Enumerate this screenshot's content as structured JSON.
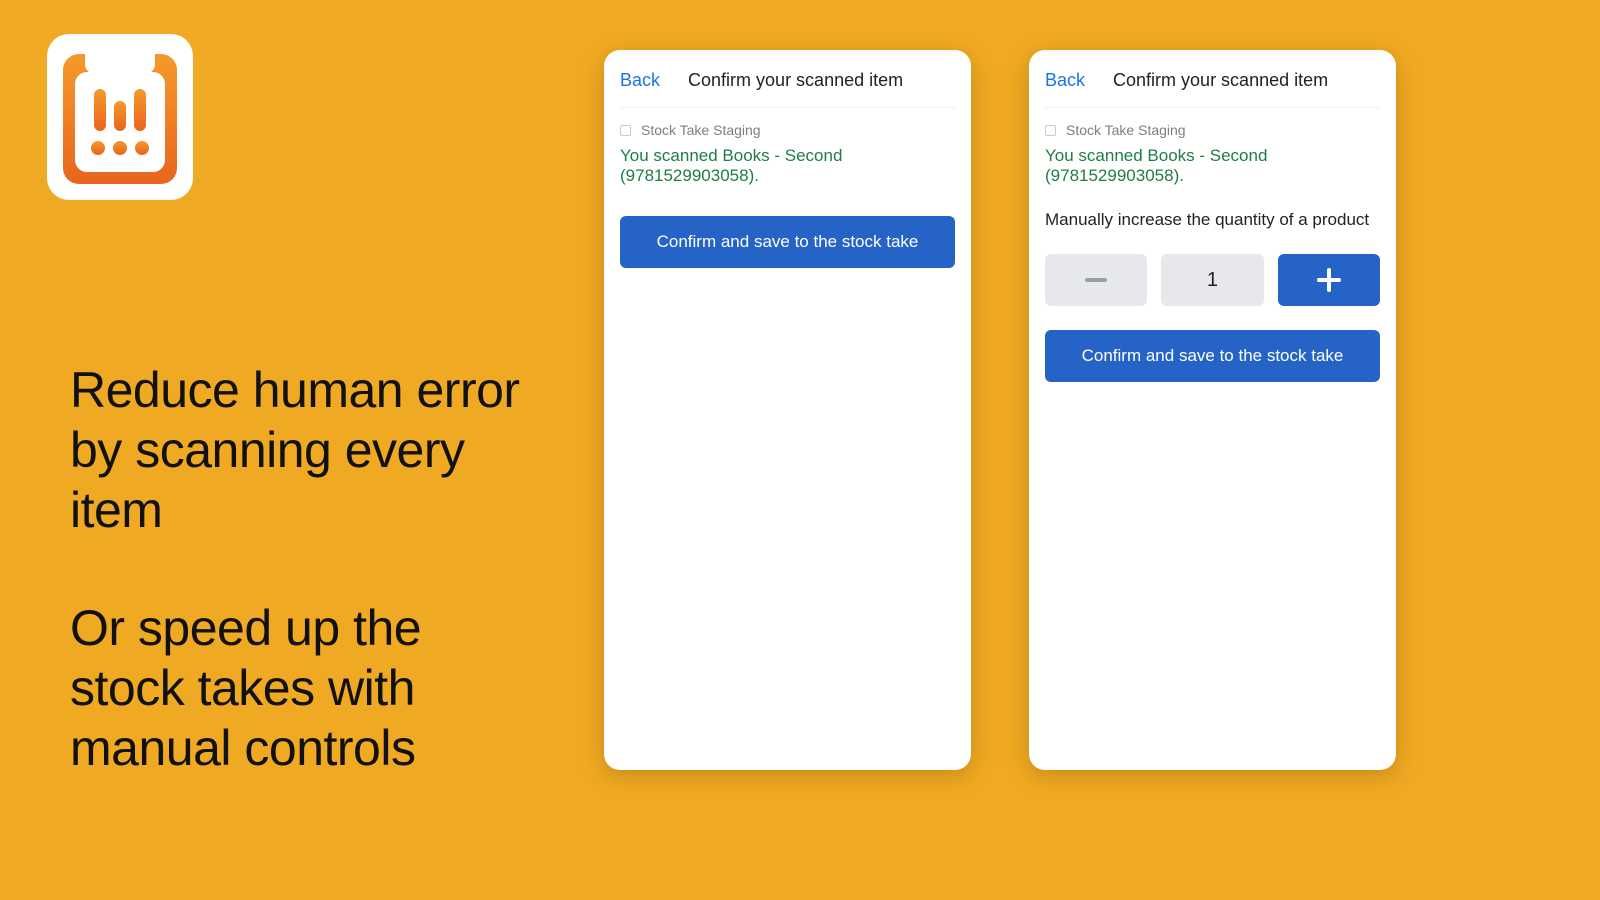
{
  "marketing": {
    "line1": "Reduce human error by scanning every item",
    "line2": "Or speed up the stock takes with manual controls"
  },
  "panel_a": {
    "back": "Back",
    "title": "Confirm your scanned item",
    "breadcrumb": "Stock Take Staging",
    "scanned": "You scanned Books - Second (9781529903058).",
    "confirm": "Confirm and save to the stock take"
  },
  "panel_b": {
    "back": "Back",
    "title": "Confirm your scanned item",
    "breadcrumb": "Stock Take Staging",
    "scanned": "You scanned Books - Second (9781529903058).",
    "manual_label": "Manually increase the quantity of a product",
    "quantity": "1",
    "confirm": "Confirm and save to the stock take"
  },
  "colors": {
    "bg": "#f0a922",
    "primary": "#2563c7",
    "link": "#1a73e8",
    "success": "#1e7d46"
  }
}
